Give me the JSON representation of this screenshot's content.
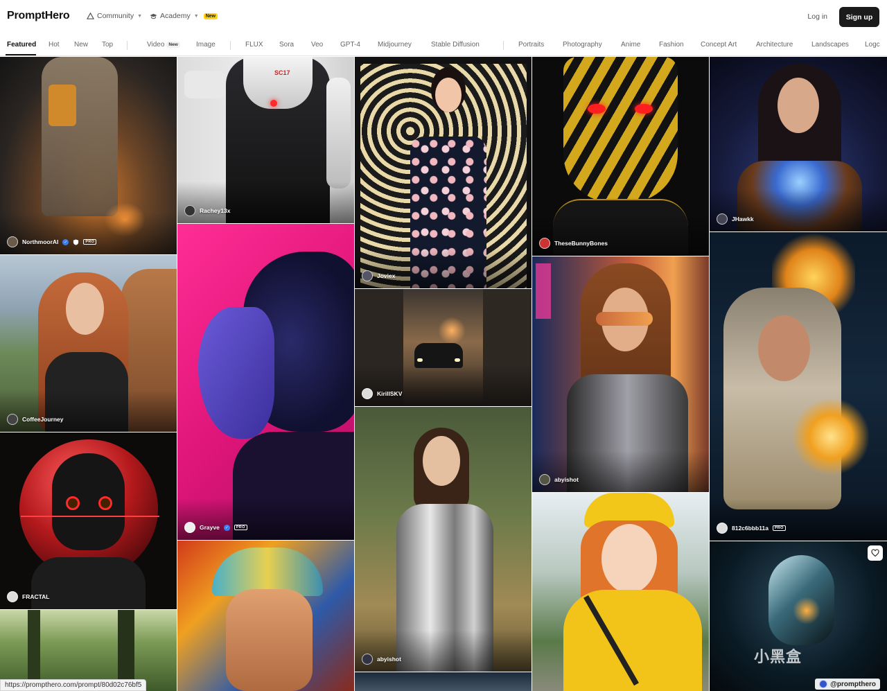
{
  "header": {
    "logo": "PromptHero",
    "community": "Community",
    "academy": "Academy",
    "academy_badge": "New",
    "login": "Log in",
    "signup": "Sign up"
  },
  "nav": {
    "featured": "Featured",
    "hot": "Hot",
    "new": "New",
    "top": "Top",
    "video": "Video",
    "video_badge": "New",
    "image": "Image",
    "flux": "FLUX",
    "sora": "Sora",
    "veo": "Veo",
    "gpt4": "GPT-4",
    "midjourney": "Midjourney",
    "stable_diffusion": "Stable Diffusion",
    "portraits": "Portraits",
    "photography": "Photography",
    "anime": "Anime",
    "fashion": "Fashion",
    "concept_art": "Concept Art",
    "architecture": "Architecture",
    "landscapes": "Landscapes",
    "logos": "Logc"
  },
  "tiles": {
    "mech": {
      "author": "NorthmoorAI",
      "pro": "PRO"
    },
    "cyborg": {
      "author": "Rachey13x",
      "suit_label": "SC17"
    },
    "dress": {
      "author": "Joviex"
    },
    "mask": {
      "author": "TheseBunnyBones"
    },
    "sorceress": {
      "author": "JHawkk"
    },
    "redhead": {
      "author": "CoffeeJourney"
    },
    "profile": {
      "author": "Grayve",
      "pro": "PRO"
    },
    "car": {
      "author": "KirillSKV"
    },
    "cyberpunk": {
      "author": "abyishot"
    },
    "wizard": {
      "author": "812c6bbb11a",
      "pro": "PRO"
    },
    "robot": {
      "author": "FRACTAL"
    },
    "knight": {
      "author": "abyishot"
    }
  },
  "status_url": "https://prompthero.com/prompt/80d02c76bf5",
  "watermark": "@prompthero",
  "site_watermark": "小黑盒"
}
